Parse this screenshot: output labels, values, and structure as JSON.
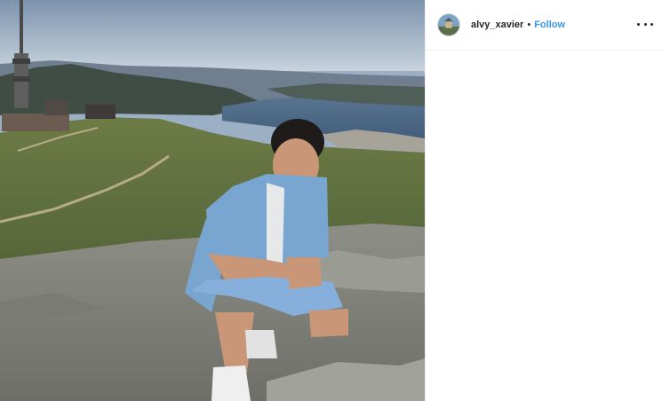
{
  "post": {
    "author": {
      "username": "alvy_xavier",
      "separator": "•",
      "follow_label": "Follow"
    },
    "menu_icon": "more-options-icon",
    "photo_subject": "photo"
  },
  "colors": {
    "follow": "#3897f0",
    "text": "#262626",
    "border": "#efefef"
  }
}
